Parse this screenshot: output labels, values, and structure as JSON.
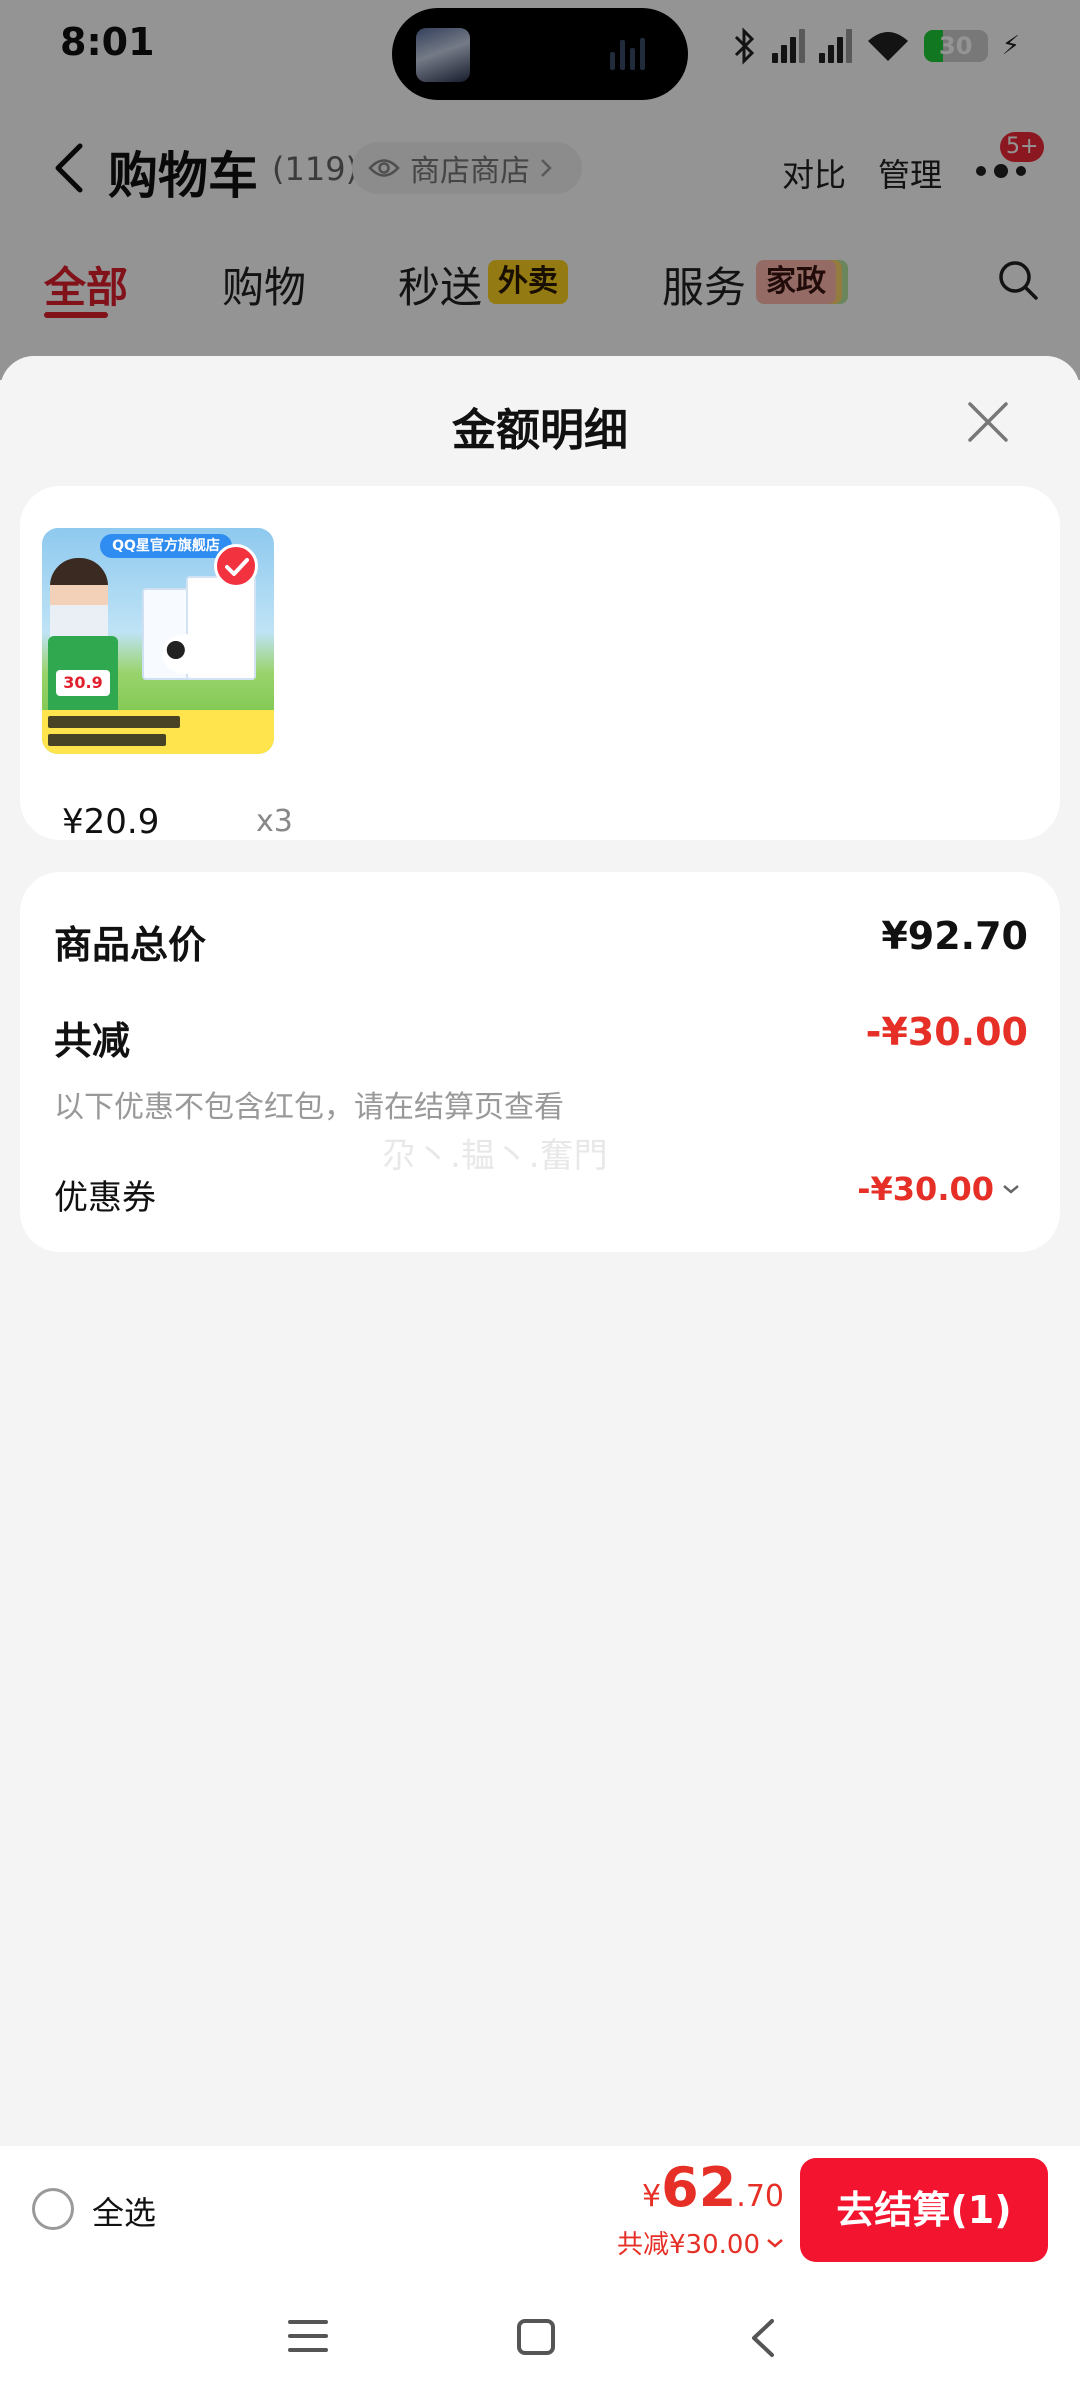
{
  "status_bar": {
    "time": "8:01",
    "battery": "30"
  },
  "header": {
    "title": "购物车",
    "count": "(119)",
    "shop_filter": "商店商店",
    "compare": "对比",
    "manage": "管理",
    "more_badge": "5+"
  },
  "tabs": [
    {
      "label": "全部"
    },
    {
      "label": "购物"
    },
    {
      "label": "秒送",
      "tag": "外卖"
    },
    {
      "label": "服务",
      "tag": "家政"
    }
  ],
  "sheet": {
    "title": "金额明细",
    "products": [
      {
        "price": "¥20.9",
        "qty": "x3",
        "image_brand": "QQ星官方旗舰店",
        "image_price": "30.9"
      }
    ],
    "summary": {
      "total_label": "商品总价",
      "total_value": "¥92.70",
      "reduce_label": "共减",
      "reduce_value": "-¥30.00",
      "note": "以下优惠不包含红包，请在结算页查看",
      "watermark": "尕丶.韫丶.奮門",
      "coupon_label": "优惠券",
      "coupon_value": "-¥30.00"
    }
  },
  "bottom_bar": {
    "select_all": "全选",
    "currency": "¥",
    "total_int": "62",
    "total_dec": ".70",
    "reduce_text": "共减¥30.00",
    "checkout": "去结算(1)"
  },
  "colors": {
    "accent": "#e0202d",
    "price_red": "#e63027",
    "checkout_bg": "#f3142f"
  }
}
